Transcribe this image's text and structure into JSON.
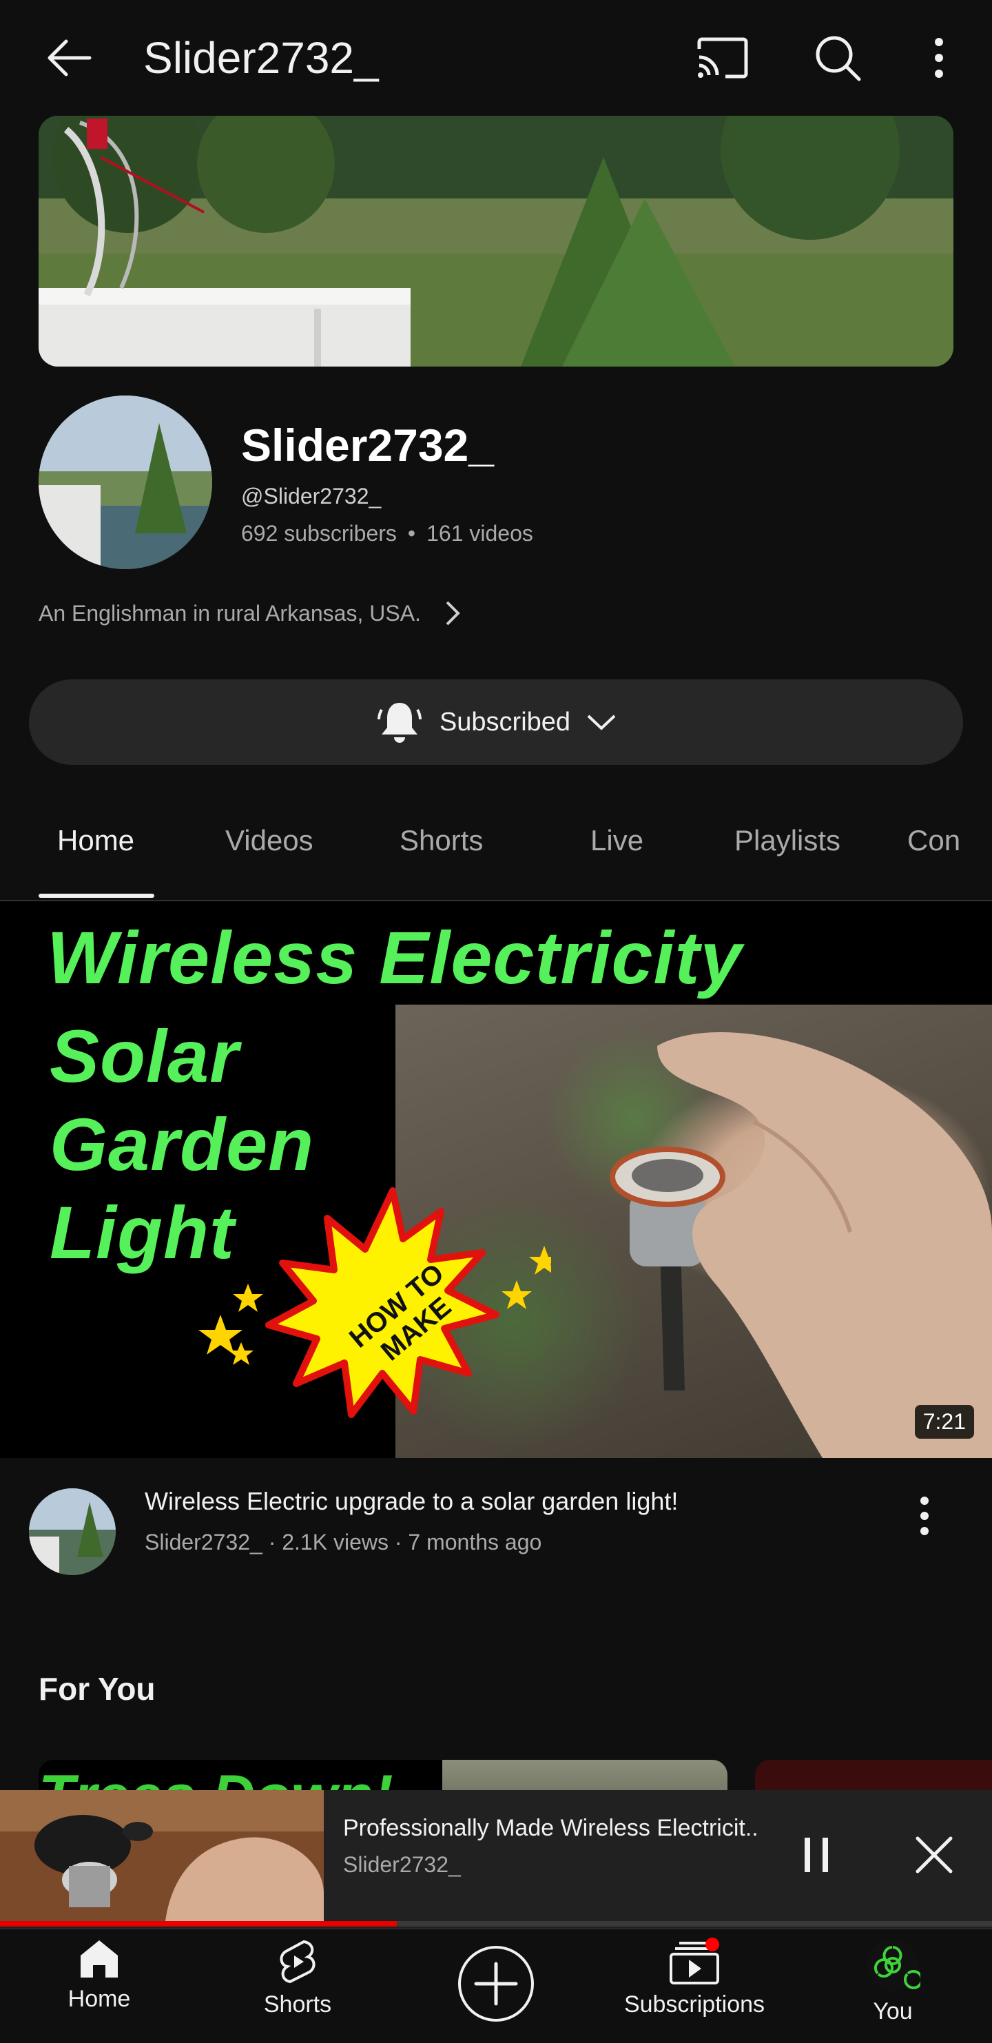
{
  "header": {
    "title": "Slider2732_",
    "icons": [
      "back-arrow-icon",
      "cast-icon",
      "search-icon",
      "more-vert-icon"
    ]
  },
  "channel": {
    "name": "Slider2732_",
    "handle": "@Slider2732_",
    "subscribers": "692 subscribers",
    "separator": "•",
    "videos": "161 videos",
    "description": "An Englishman in rural Arkansas, USA."
  },
  "subscribe": {
    "label": "Subscribed"
  },
  "tabs": [
    {
      "label": "Home",
      "active": true
    },
    {
      "label": "Videos",
      "active": false
    },
    {
      "label": "Shorts",
      "active": false
    },
    {
      "label": "Live",
      "active": false
    },
    {
      "label": "Playlists",
      "active": false
    },
    {
      "label": "Con",
      "active": false
    }
  ],
  "featured": {
    "thumb_line1": "Wireless Electricity",
    "thumb_line2": "Solar",
    "thumb_line3": "Garden",
    "thumb_line4": "Light",
    "burst_text": "HOW TO MAKE",
    "duration": "7:21",
    "title": "Wireless Electric upgrade to a solar garden light!",
    "meta": "Slider2732_ · 2.1K views · 7 months ago"
  },
  "for_you": {
    "heading": "For You",
    "card1_text": "Trees Down!"
  },
  "mini_player": {
    "title": "Professionally Made Wireless Electricit..",
    "channel": "Slider2732_",
    "progress_percent": 40
  },
  "bottom_nav": [
    {
      "label": "Home",
      "icon": "home-icon"
    },
    {
      "label": "Shorts",
      "icon": "shorts-icon"
    },
    {
      "label": "",
      "icon": "create-plus-icon"
    },
    {
      "label": "Subscriptions",
      "icon": "subscriptions-icon"
    },
    {
      "label": "You",
      "icon": "you-avatar-icon"
    }
  ],
  "colors": {
    "background": "#0f0f0f",
    "thumb_green": "#56f05a",
    "progress_red": "#e60000",
    "notification_red": "#ff0000"
  }
}
